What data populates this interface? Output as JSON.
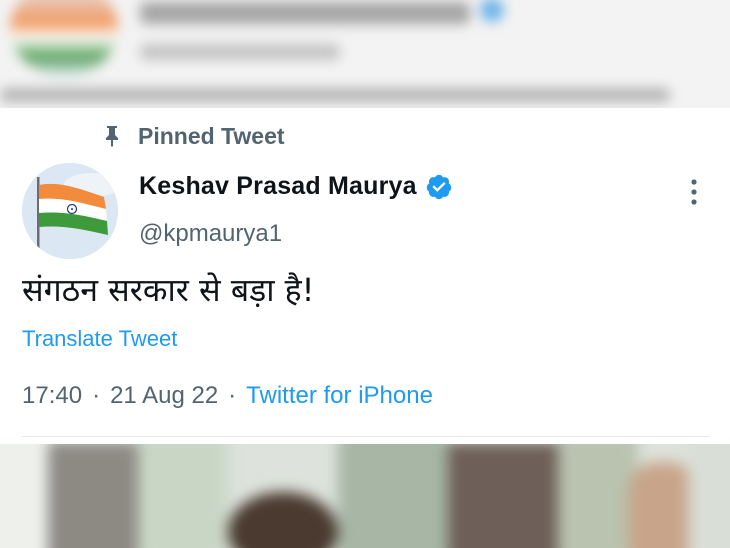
{
  "pinned": {
    "label": "Pinned Tweet",
    "icon": "pin-icon"
  },
  "author": {
    "name": "Keshav Prasad Maurya",
    "handle": "@kpmaurya1",
    "verified": true,
    "verified_color": "#1d9bf0"
  },
  "tweet": {
    "text": "संगठन सरकार से बड़ा है!",
    "translate_label": "Translate Tweet",
    "time": "17:40",
    "date": "21 Aug 22",
    "separator": "·",
    "source": "Twitter for iPhone"
  },
  "colors": {
    "link": "#1d9bf0",
    "secondary_text": "#536471",
    "primary_text": "#0f1419"
  }
}
